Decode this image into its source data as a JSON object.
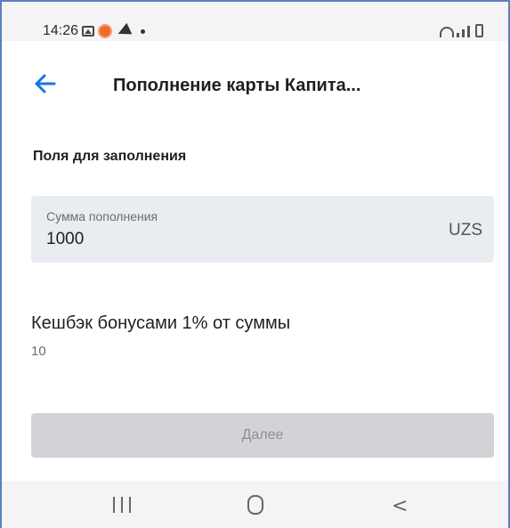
{
  "status_bar": {
    "time": "14:26",
    "left_icons": [
      "gallery-icon",
      "app-notification-icon",
      "telegram-icon",
      "dot-icon"
    ],
    "right_icons": [
      "wifi-icon",
      "signal-icon",
      "battery-icon"
    ]
  },
  "app_bar": {
    "back_icon": "arrow-left-icon",
    "title": "Пополнение карты Капита..."
  },
  "form": {
    "section_heading": "Поля для заполнения",
    "amount_field": {
      "label": "Сумма пополнения",
      "value": "1000",
      "currency": "UZS"
    }
  },
  "cashback": {
    "label": "Кешбэк бонусами 1% от суммы",
    "value": "10"
  },
  "next_button": {
    "label": "Далее",
    "enabled": false
  },
  "nav_bar": {
    "icons": [
      "recent-apps-icon",
      "home-icon",
      "back-icon"
    ]
  },
  "colors": {
    "accent": "#1a73e8",
    "field_bg": "#e9ecf0",
    "button_disabled_bg": "#d2d3d6",
    "button_disabled_text": "#8e8f92",
    "frame_border": "#5b7fc0"
  }
}
